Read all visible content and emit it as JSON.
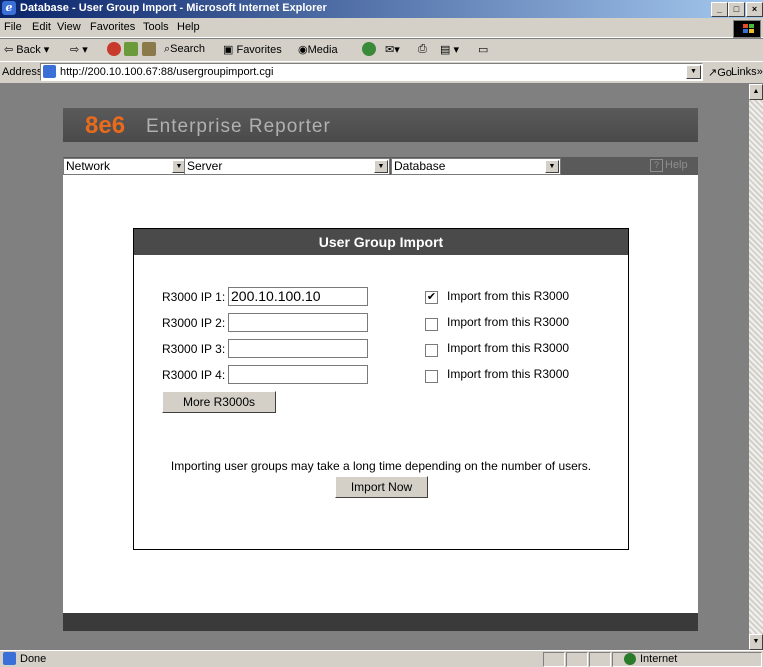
{
  "window": {
    "title": "Database - User Group Import - Microsoft Internet Explorer",
    "controls": [
      "_",
      "□",
      "×"
    ]
  },
  "menu": [
    "File",
    "Edit",
    "View",
    "Favorites",
    "Tools",
    "Help"
  ],
  "toolbar": {
    "back": "Back",
    "search": "Search",
    "favorites": "Favorites",
    "media": "Media"
  },
  "address": {
    "label": "Address",
    "url": "http://200.10.100.67:88/usergroupimport.cgi",
    "go": "Go",
    "links": "Links"
  },
  "app": {
    "logo_brand": "8e6",
    "logo_text": "Enterprise Reporter",
    "nav": {
      "network": "Network",
      "server": "Server",
      "database": "Database",
      "help": "Help"
    }
  },
  "panel": {
    "title": "User Group Import",
    "rows": [
      {
        "label": "R3000 IP 1:",
        "value": "200.10.100.10",
        "checked": true,
        "check_label": "Import from this R3000"
      },
      {
        "label": "R3000 IP 2:",
        "value": "",
        "checked": false,
        "check_label": "Import from this R3000"
      },
      {
        "label": "R3000 IP 3:",
        "value": "",
        "checked": false,
        "check_label": "Import from this R3000"
      },
      {
        "label": "R3000 IP 4:",
        "value": "",
        "checked": false,
        "check_label": "Import from this R3000"
      }
    ],
    "more_button": "More R3000s",
    "info": "Importing user groups may take a long time depending on the number of users.",
    "import_button": "Import Now"
  },
  "status": {
    "left": "Done",
    "zone": "Internet"
  },
  "colors": {
    "titlebar": "#0a246a",
    "brand_orange": "#e86a1c",
    "panel_header": "#4a4a4a"
  }
}
